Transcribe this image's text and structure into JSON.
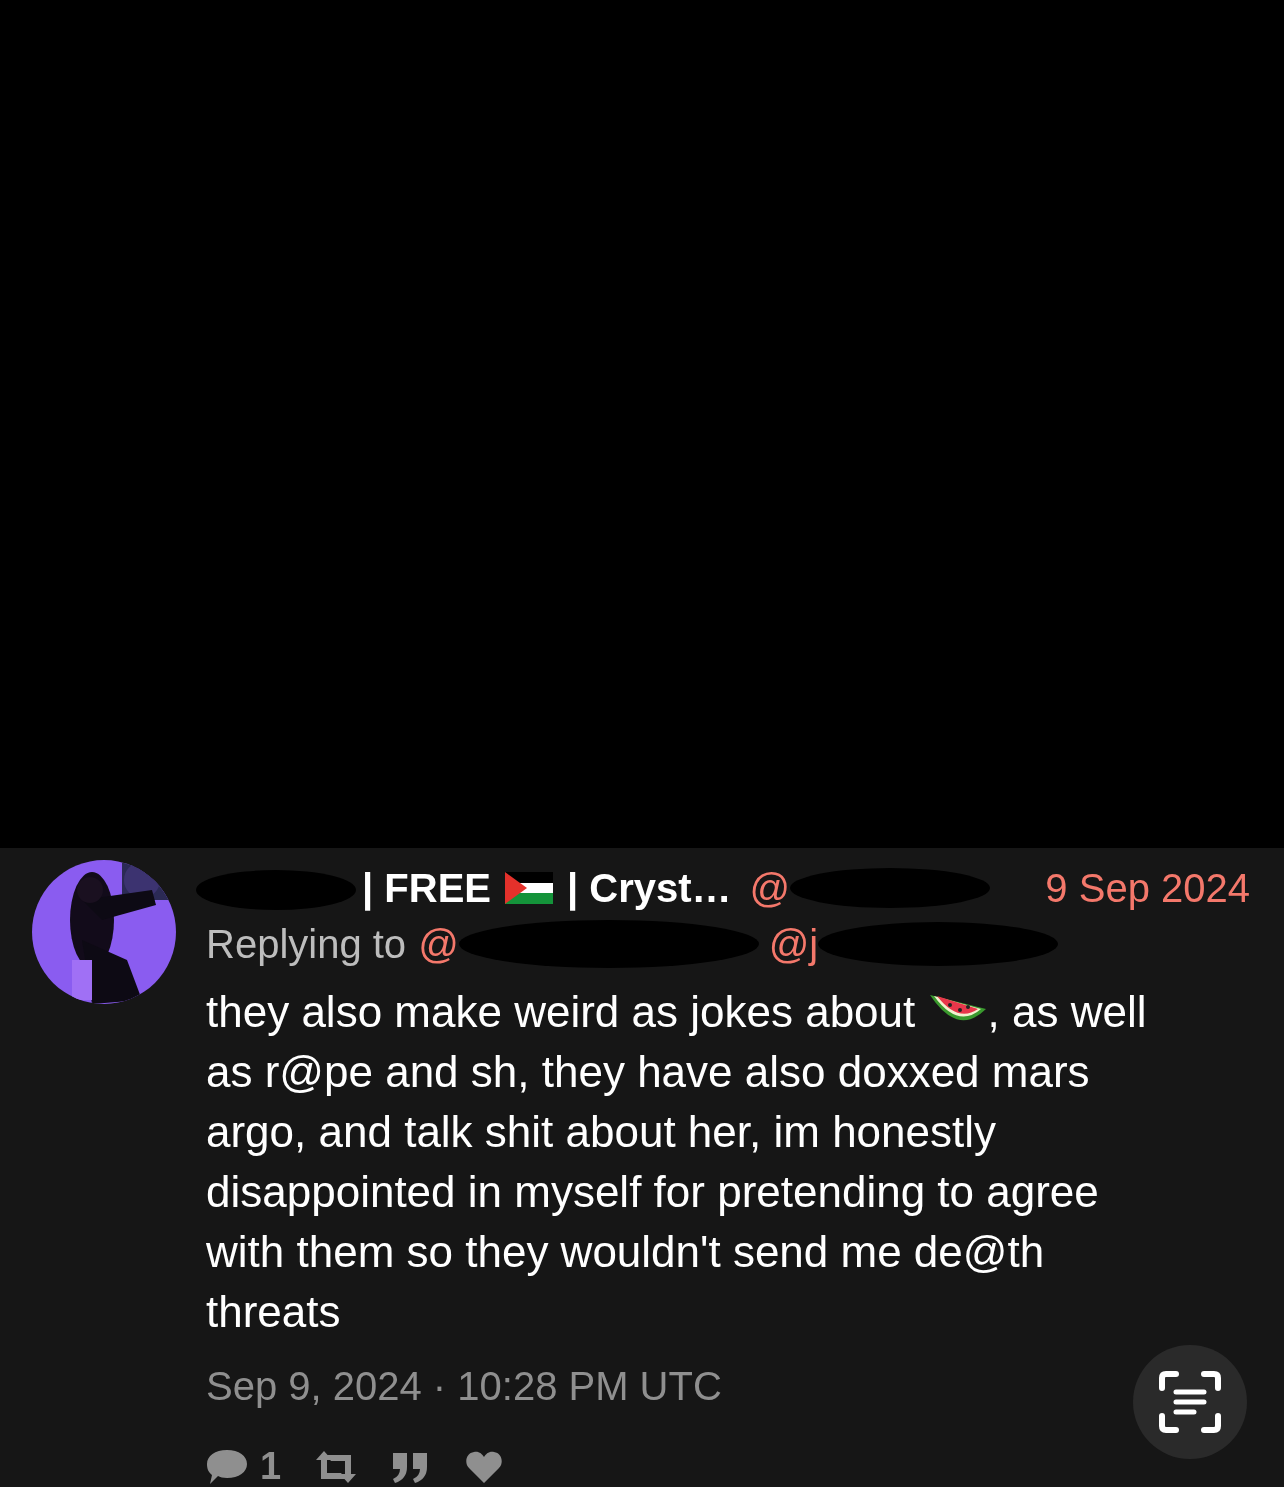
{
  "tweet": {
    "name_parts": [
      "| FREE",
      "| Cryst…"
    ],
    "handle": "@",
    "date": "9 Sep 2024",
    "replying_label": "Replying to",
    "reply_handles": [
      "@",
      "@j"
    ],
    "body_before": "they also make weird as jokes about",
    "body_after": ", as well as r@pe and sh, they have also doxxed mars argo, and talk shit about her, im honestly disappointed in myself for pretending to agree with them so they wouldn't send me de@th threats",
    "timestamp": "Sep 9, 2024 · 10:28 PM UTC",
    "stats": {
      "replies": "1"
    }
  }
}
